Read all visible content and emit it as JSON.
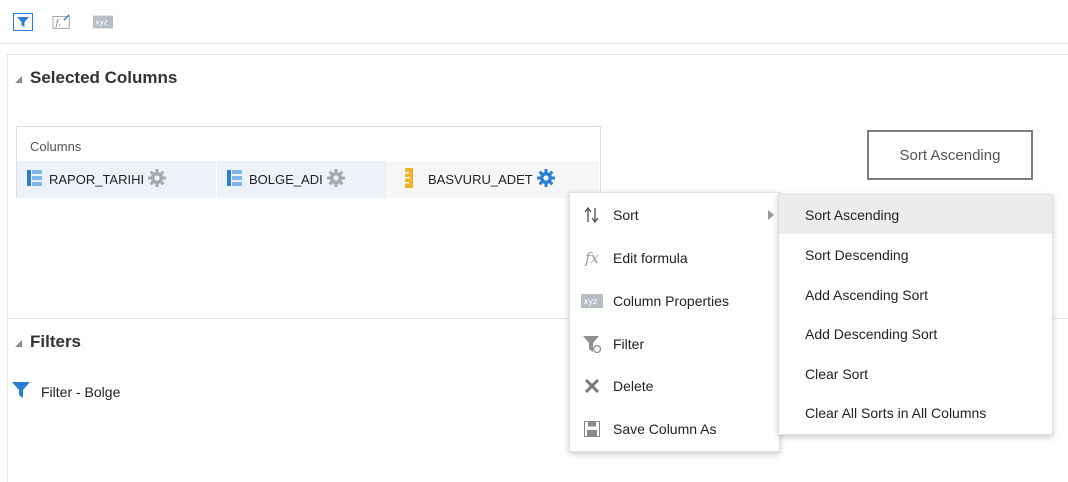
{
  "toolbar": {
    "icons": [
      "filter-icon",
      "formula-icon",
      "column-properties-icon"
    ],
    "column_props_label": "xyz"
  },
  "selected_columns": {
    "title": "Selected Columns",
    "columns_label": "Columns",
    "columns": [
      {
        "name": "RAPOR_TARIHI",
        "icon": "attribute-column-icon"
      },
      {
        "name": "BOLGE_ADI",
        "icon": "attribute-column-icon"
      },
      {
        "name": "BASVURU_ADET",
        "icon": "measure-column-icon",
        "active": true
      }
    ]
  },
  "preview_button": {
    "label": "Sort Ascending"
  },
  "context_menu": {
    "items": [
      {
        "label": "Sort",
        "icon": "sort-icon",
        "has_submenu": true
      },
      {
        "label": "Edit formula",
        "icon": "fx-icon"
      },
      {
        "label": "Column Properties",
        "icon": "column-properties-icon"
      },
      {
        "label": "Filter",
        "icon": "filter-icon"
      },
      {
        "label": "Delete",
        "icon": "delete-icon"
      },
      {
        "label": "Save Column As",
        "icon": "save-icon"
      }
    ]
  },
  "sort_submenu": {
    "items": [
      {
        "label": "Sort Ascending",
        "highlighted": true
      },
      {
        "label": "Sort Descending"
      },
      {
        "label": "Add Ascending Sort"
      },
      {
        "label": "Add Descending Sort"
      },
      {
        "label": "Clear Sort"
      },
      {
        "label": "Clear All Sorts in All Columns"
      }
    ]
  },
  "filters": {
    "title": "Filters",
    "items": [
      {
        "label": "Filter - Bolge",
        "icon": "filter-icon"
      }
    ]
  },
  "colors": {
    "accent_blue": "#2a7fd4",
    "gear_gray": "#a8a8a8",
    "measure_yellow": "#f0b429",
    "highlight": "#ececec"
  }
}
